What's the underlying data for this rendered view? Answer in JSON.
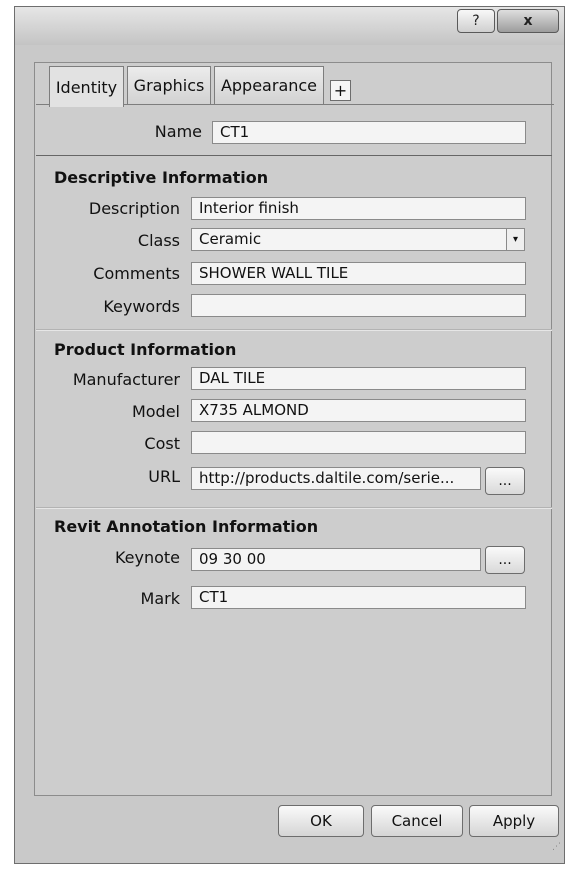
{
  "titlebar": {
    "help_icon": "?",
    "close_icon": "x"
  },
  "tabs": [
    {
      "label": "Identity",
      "active": true
    },
    {
      "label": "Graphics"
    },
    {
      "label": "Appearance"
    }
  ],
  "add_tab_label": "+",
  "name": {
    "label": "Name",
    "value": "CT1"
  },
  "descriptive": {
    "header": "Descriptive Information",
    "description": {
      "label": "Description",
      "value": "Interior finish"
    },
    "class": {
      "label": "Class",
      "value": "Ceramic"
    },
    "comments": {
      "label": "Comments",
      "value": "SHOWER WALL TILE"
    },
    "keywords": {
      "label": "Keywords",
      "value": ""
    }
  },
  "product": {
    "header": "Product Information",
    "manufacturer": {
      "label": "Manufacturer",
      "value": "DAL TILE"
    },
    "model": {
      "label": "Model",
      "value": "X735 ALMOND"
    },
    "cost": {
      "label": "Cost",
      "value": ""
    },
    "url": {
      "label": "URL",
      "value": "http://products.daltile.com/serie..."
    }
  },
  "revit": {
    "header": "Revit Annotation Information",
    "keynote": {
      "label": "Keynote",
      "value": "09 30 00"
    },
    "mark": {
      "label": "Mark",
      "value": "CT1"
    }
  },
  "browse_label": "...",
  "buttons": {
    "ok": "OK",
    "cancel": "Cancel",
    "apply": "Apply"
  },
  "dropdown_icon": "▾"
}
